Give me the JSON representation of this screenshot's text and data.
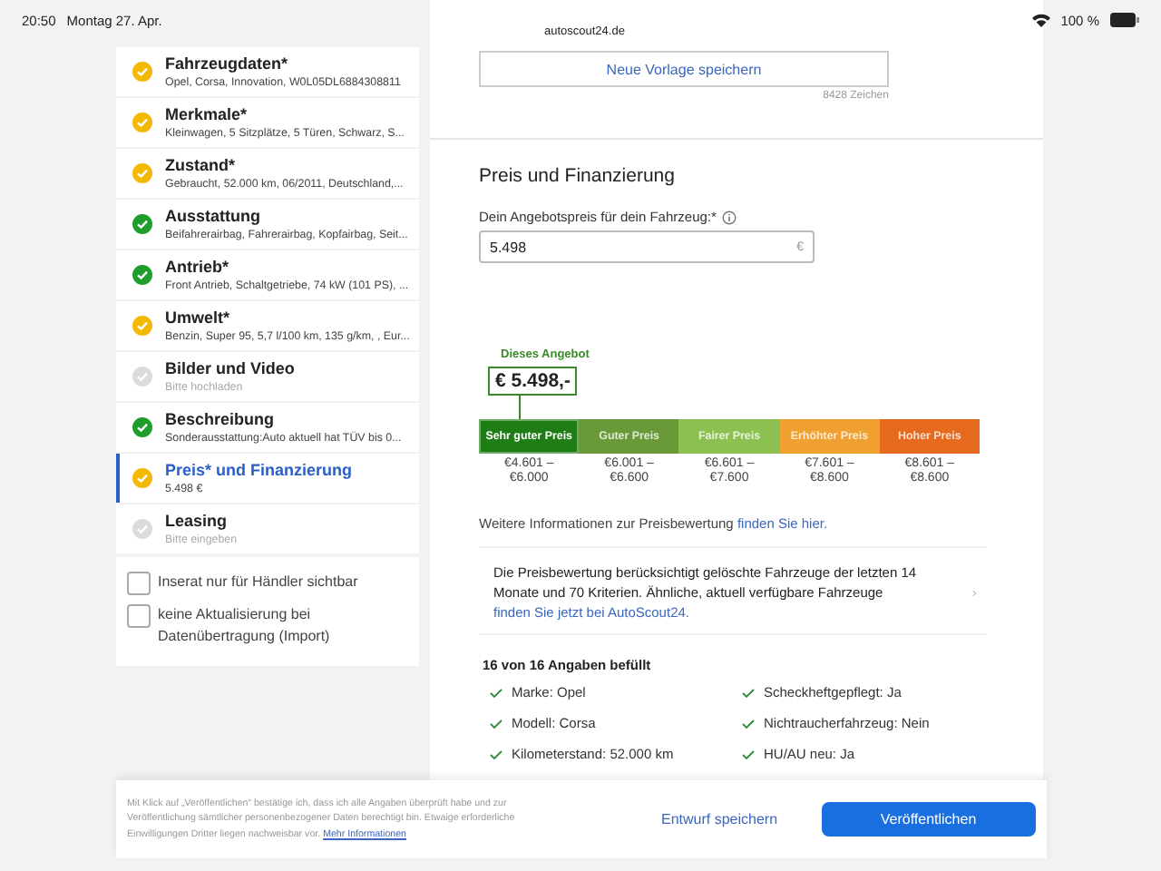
{
  "status_bar": {
    "time": "20:50",
    "date": "Montag 27. Apr.",
    "url": "autoscout24.de",
    "battery": "100 %"
  },
  "sidebar": {
    "items": [
      {
        "title": "Fahrzeugdaten*",
        "subtitle": "Opel, Corsa, Innovation, W0L05DL6884308811",
        "kind": "warning",
        "selected": false
      },
      {
        "title": "Merkmale*",
        "subtitle": "Kleinwagen, 5 Sitzplätze, 5 Türen, Schwarz, S...",
        "kind": "warning",
        "selected": false
      },
      {
        "title": "Zustand*",
        "subtitle": "Gebraucht, 52.000 km, 06/2011, Deutschland,...",
        "kind": "warning",
        "selected": false
      },
      {
        "title": "Ausstattung",
        "subtitle": "Beifahrerairbag, Fahrerairbag, Kopfairbag, Seit...",
        "kind": "done",
        "selected": false
      },
      {
        "title": "Antrieb*",
        "subtitle": "Front Antrieb, Schaltgetriebe, 74 kW (101 PS), ...",
        "kind": "done",
        "selected": false
      },
      {
        "title": "Umwelt*",
        "subtitle": "Benzin, Super 95, 5,7 l/100 km, 135 g/km, , Eur...",
        "kind": "warning",
        "selected": false
      },
      {
        "title": "Bilder und Video",
        "subtitle": "Bitte hochladen",
        "kind": "empty",
        "selected": false
      },
      {
        "title": "Beschreibung",
        "subtitle": "Sonderausstattung:Auto aktuell hat TÜV bis 0...",
        "kind": "done",
        "selected": false
      },
      {
        "title": "Preis* und Finanzierung",
        "subtitle": "5.498 €",
        "kind": "warning",
        "selected": true
      },
      {
        "title": "Leasing",
        "subtitle": "Bitte eingeben",
        "kind": "empty",
        "selected": false
      }
    ],
    "options": [
      {
        "label": "Inserat nur für Händler sichtbar",
        "checked": false
      },
      {
        "label": "keine Aktualisierung bei Datenübertragung (Import)",
        "checked": false
      }
    ]
  },
  "description": {
    "template_button": "Neue Vorlage speichern",
    "char_count": "8428 Zeichen"
  },
  "price": {
    "heading": "Preis und Finanzierung",
    "label": "Dein Angebotspreis für dein Fahrzeug:*",
    "value": "5.498",
    "currency": "€",
    "offer_caption": "Dieses Angebot",
    "offer_value": "€ 5.498,-",
    "segments": [
      {
        "label": "Sehr guter Preis",
        "range": "€4.601 –\n€6.000",
        "color": "#1e7d14",
        "selected": true
      },
      {
        "label": "Guter Preis",
        "range": "€6.001 –\n€6.600",
        "color": "#6a9a38",
        "selected": false
      },
      {
        "label": "Fairer Preis",
        "range": "€6.601 –\n€7.600",
        "color": "#8cc152",
        "selected": false
      },
      {
        "label": "Erhöhter Preis",
        "range": "€7.601 –\n€8.600",
        "color": "#f0a030",
        "selected": false
      },
      {
        "label": "Hoher Preis",
        "range": "€8.601 –\n€8.600",
        "color": "#e56a1e",
        "selected": false
      }
    ],
    "info_text": "Weitere Informationen zur Preisbewertung ",
    "info_link": "finden Sie hier.",
    "note_text": "Die Preisbewertung berücksichtigt gelöschte Fahrzeuge der letzten 14 Monate und 70 Kriterien. Ähnliche, aktuell verfügbare Fahrzeuge ",
    "note_link": "finden Sie jetzt bei AutoScout24."
  },
  "completeness": {
    "heading": "16 von 16 Angaben befüllt",
    "items": [
      "Marke: Opel",
      "Scheckheftgepflegt: Ja",
      "Modell: Corsa",
      "Nichtraucherfahrzeug: Nein",
      "Kilometerstand: 52.000 km",
      "HU/AU neu: Ja"
    ]
  },
  "footer": {
    "legal": "Mit Klick auf „Veröffentlichen“ bestätige ich, dass ich alle Angaben überprüft habe und zur Veröffentlichung sämtlicher personenbezogener Daten berechtigt bin. Etwaige erforderliche Einwilligungen Dritter liegen nachweisbar vor.",
    "legal_link": "Mehr Informationen",
    "draft_button": "Entwurf speichern",
    "publish_button": "Veröffentlichen"
  }
}
